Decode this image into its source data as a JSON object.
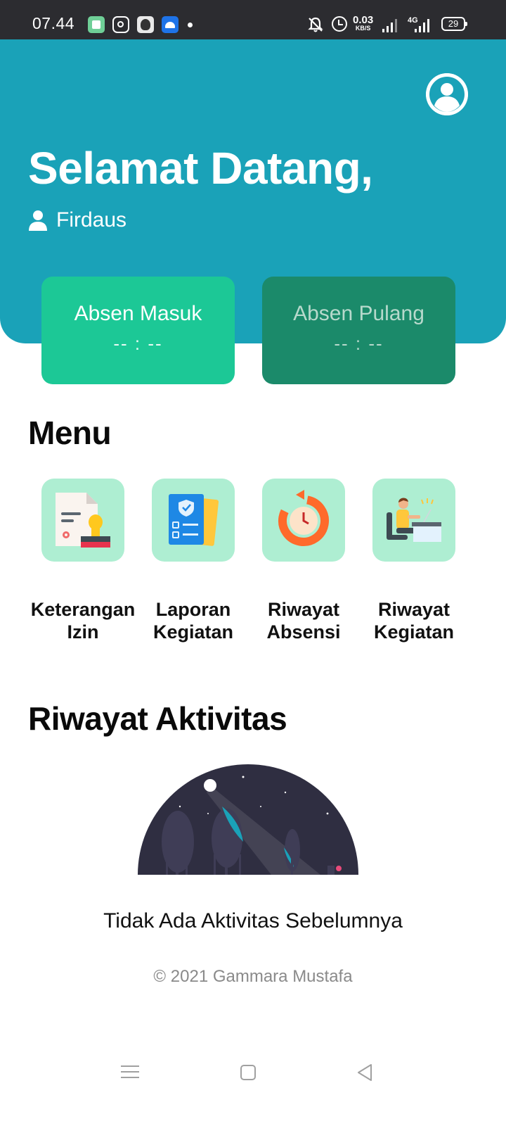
{
  "status_bar": {
    "time": "07.44",
    "net_speed_value": "0.03",
    "net_speed_unit": "KB/S",
    "network": "4G",
    "battery": "29",
    "icons": [
      "app-icon",
      "instagram-icon",
      "app-icon",
      "android-icon",
      "notification-dot-icon",
      "mute-bell-icon",
      "alarm-icon",
      "signal-icon",
      "signal-4g-icon",
      "battery-icon"
    ]
  },
  "header": {
    "welcome": "Selamat Datang,",
    "username": "Firdaus",
    "profile_icon": "account-circle-icon",
    "user_icon": "person-icon",
    "background_color": "#1aa2b8"
  },
  "attendance": {
    "check_in": {
      "label": "Absen Masuk",
      "time": "-- : --",
      "color": "#1cc896"
    },
    "check_out": {
      "label": "Absen Pulang",
      "time": "-- : --",
      "color": "#1b8a6a"
    }
  },
  "menu": {
    "title": "Menu",
    "items": [
      {
        "label": "Keterangan\nIzin",
        "icon": "permit-document-stamp-icon"
      },
      {
        "label": "Laporan\nKegiatan",
        "icon": "report-checklist-icon"
      },
      {
        "label": "Riwayat\nAbsensi",
        "icon": "attendance-history-clock-icon"
      },
      {
        "label": "Riwayat\nKegiatan",
        "icon": "person-working-desk-icon"
      }
    ],
    "icon_background": "#aeeed2"
  },
  "history": {
    "title": "Riwayat Aktivitas",
    "empty_illustration": "night-forest-illustration",
    "empty_text": "Tidak Ada Aktivitas Sebelumnya"
  },
  "footer": {
    "text": "© 2021 Gammara Mustafa"
  },
  "nav_bar": {
    "icons": [
      "recent-apps-icon",
      "home-icon",
      "back-icon"
    ]
  }
}
